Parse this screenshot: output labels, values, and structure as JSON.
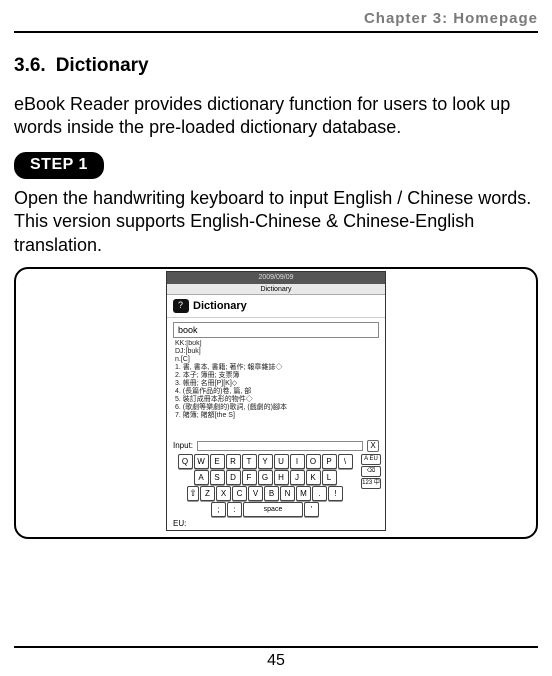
{
  "header": {
    "chapter": "Chapter 3: Homepage"
  },
  "section": {
    "number": "3.6.",
    "title": "Dictionary"
  },
  "paragraphs": {
    "intro": "eBook Reader provides dictionary function for users to look up words inside the pre-loaded dictionary database.",
    "step1_body": "Open the handwriting keyboard to input English / Chinese words. This version supports English-Chinese & Chinese-English translation."
  },
  "step_label": "STEP 1",
  "page_number": "45",
  "device": {
    "date": "2009/09/09",
    "title": "Dictionary",
    "brand": "Dictionary",
    "word": "book",
    "phonetics": {
      "kk": "KK:[bʊk]",
      "dj": "DJ:[buk]"
    },
    "pos": "n.[C]",
    "defs": [
      "1. 書, 書本, 書籍; 著作; 報章雜誌◇",
      "2. 本子; 簿冊; 支票簿",
      "3. 帳冊; 名冊[P][K]◇",
      "4. (長篇作品的)卷, 篇, 部",
      "5. 裝訂成冊本形的物件◇",
      "6. (歌劇等樂劇的)歌詞, (戲劇的)腳本",
      "7. 賭簿; 賭額[the S]"
    ],
    "input_label": "Input:",
    "close_x": "X",
    "eu_label": "EU:",
    "keyboard": {
      "row1": [
        "Q",
        "W",
        "E",
        "R",
        "T",
        "Y",
        "U",
        "I",
        "O",
        "P",
        "\\"
      ],
      "row2": [
        "A",
        "S",
        "D",
        "F",
        "G",
        "H",
        "J",
        "K",
        "L"
      ],
      "row3_shift": "⇧",
      "row3": [
        "Z",
        "X",
        "C",
        "V",
        "B",
        "N",
        "M",
        ".",
        "!"
      ],
      "row4": [
        ";",
        ":"
      ],
      "space": "space",
      "row4_end": [
        "'"
      ],
      "side": [
        "A EU",
        "⌫",
        "123 中"
      ]
    }
  }
}
